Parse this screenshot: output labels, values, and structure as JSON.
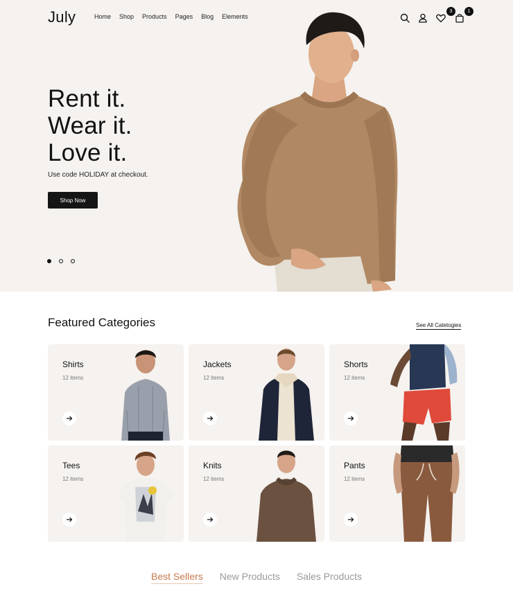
{
  "header": {
    "logo": "July",
    "nav": [
      "Home",
      "Shop",
      "Products",
      "Pages",
      "Blog",
      "Elements"
    ],
    "wishlist_count": "3",
    "cart_count": "1"
  },
  "hero": {
    "lines": [
      "Rent it.",
      "Wear it.",
      "Love it."
    ],
    "subline": "Use code HOLIDAY at checkout.",
    "cta": "Shop Now",
    "slides_total": 3,
    "active_slide": 1
  },
  "featured": {
    "title": "Featured Categories",
    "see_all": "See All Catetogies",
    "categories": [
      {
        "name": "Shirts",
        "count": "12 items"
      },
      {
        "name": "Jackets",
        "count": "12 items"
      },
      {
        "name": "Shorts",
        "count": "12 items"
      },
      {
        "name": "Tees",
        "count": "12 items"
      },
      {
        "name": "Knits",
        "count": "12 items"
      },
      {
        "name": "Pants",
        "count": "12 items"
      }
    ]
  },
  "tabs": [
    "Best Sellers",
    "New Products",
    "Sales Products"
  ],
  "colors": {
    "hero_bg": "#f5f2ef",
    "accent": "#c67a4e",
    "sweater": "#b08863"
  }
}
